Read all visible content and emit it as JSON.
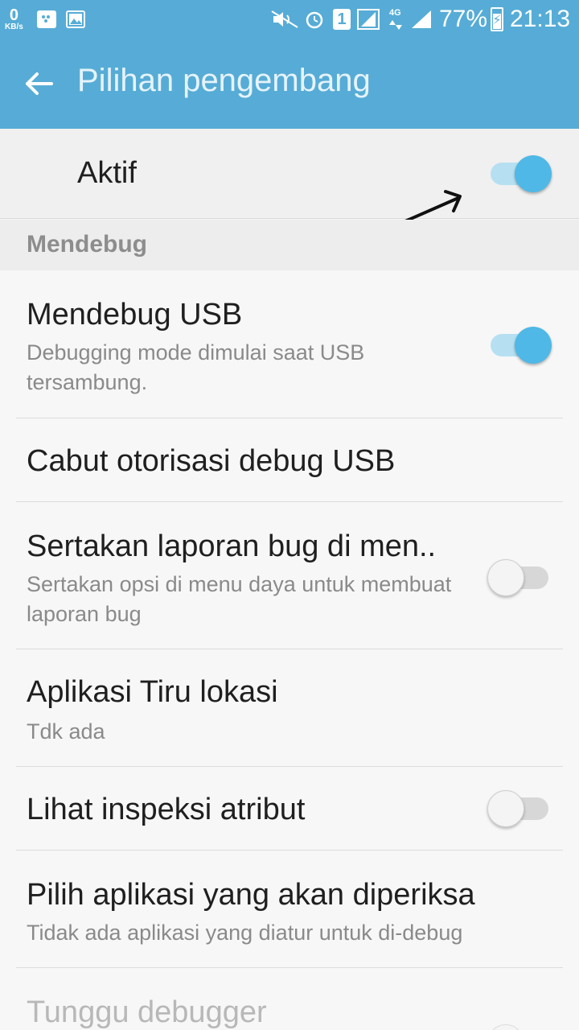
{
  "status_bar": {
    "speed_value": "0",
    "speed_unit": "KB/s",
    "sim_label": "1",
    "network_type": "4G",
    "battery_percent": "77%",
    "time": "21:13",
    "icons": [
      "bbm-icon",
      "gallery-icon",
      "mute-icon",
      "alarm-icon",
      "sim-icon",
      "signal-icon",
      "battery-icon"
    ]
  },
  "app_bar": {
    "title": "Pilihan pengembang",
    "back_icon": "back-arrow-icon"
  },
  "master_switch": {
    "label": "Aktif",
    "on": true
  },
  "section": {
    "title": "Mendebug"
  },
  "items": [
    {
      "title": "Mendebug USB",
      "subtitle": "Debugging mode dimulai saat USB tersambung.",
      "toggle": "on"
    },
    {
      "title": "Cabut otorisasi debug USB",
      "subtitle": "",
      "toggle": "none"
    },
    {
      "title": "Sertakan laporan bug di men..",
      "subtitle": "Sertakan opsi di menu daya untuk membuat laporan bug",
      "toggle": "off"
    },
    {
      "title": "Aplikasi Tiru lokasi",
      "subtitle": "Tdk ada",
      "toggle": "none"
    },
    {
      "title": "Lihat inspeksi atribut",
      "subtitle": "",
      "toggle": "off"
    },
    {
      "title": "Pilih aplikasi yang akan diperiksa",
      "subtitle": "Tidak ada aplikasi yang diatur untuk di-debug",
      "toggle": "none"
    },
    {
      "title": "Tunggu debugger",
      "subtitle": "",
      "toggle": "off",
      "disabled": true
    }
  ],
  "colors": {
    "accent": "#56acd6",
    "toggle_on": "#4fb8e6",
    "toggle_track_on": "#b6e0f2"
  }
}
